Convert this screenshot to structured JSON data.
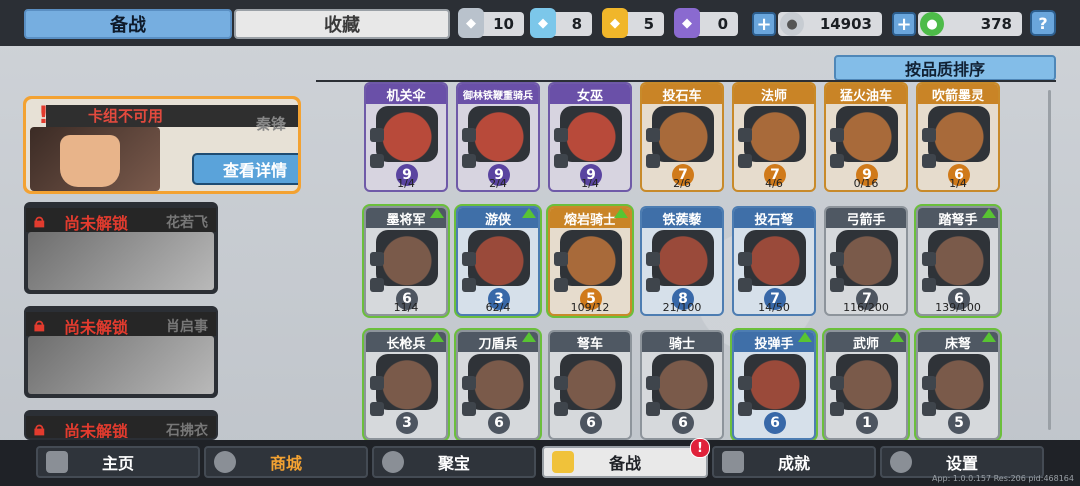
{
  "tabs": {
    "main": "备战",
    "collection": "收藏"
  },
  "resources": [
    {
      "name": "silver-shield",
      "value": "10",
      "color": "#b9c2cc"
    },
    {
      "name": "blue-shield",
      "value": "8",
      "color": "#7cc7ea"
    },
    {
      "name": "gold-shield",
      "value": "5",
      "color": "#f0b62a"
    },
    {
      "name": "purple-shield",
      "value": "0",
      "color": "#8a6ad0"
    }
  ],
  "currency": {
    "silver": "14903",
    "gem": "378"
  },
  "help": "?",
  "sort_button": "按品质排序",
  "commanders": {
    "active": {
      "status": "卡组不可用",
      "name": "秦锋",
      "detail_button": "查看详情"
    },
    "locked": [
      {
        "label": "尚未解锁",
        "name": "花若飞"
      },
      {
        "label": "尚未解锁",
        "name": "肖启事"
      },
      {
        "label": "尚未解锁",
        "name": "石拂衣"
      }
    ]
  },
  "units": [
    {
      "name": "机关伞",
      "level": "9",
      "count": "1/4",
      "rarity": "purple"
    },
    {
      "name": "御林铁鞭重骑兵",
      "level": "9",
      "count": "2/4",
      "rarity": "purple"
    },
    {
      "name": "女巫",
      "level": "9",
      "count": "1/4",
      "rarity": "purple"
    },
    {
      "name": "投石车",
      "level": "7",
      "count": "2/6",
      "rarity": "orange"
    },
    {
      "name": "法师",
      "level": "7",
      "count": "4/6",
      "rarity": "orange"
    },
    {
      "name": "猛火油车",
      "level": "9",
      "count": "0/16",
      "rarity": "orange"
    },
    {
      "name": "吹箭墨灵",
      "level": "6",
      "count": "1/4",
      "rarity": "orange"
    },
    {
      "name": "墨将军",
      "level": "6",
      "count": "11/4",
      "rarity": "gray",
      "upgrade": true
    },
    {
      "name": "游侠",
      "level": "3",
      "count": "62/4",
      "rarity": "blue",
      "upgrade": true
    },
    {
      "name": "熔岩骑士",
      "level": "5",
      "count": "109/12",
      "rarity": "orange",
      "upgrade": true
    },
    {
      "name": "铁蒺藜",
      "level": "8",
      "count": "21/100",
      "rarity": "blue"
    },
    {
      "name": "投石弩",
      "level": "7",
      "count": "14/50",
      "rarity": "blue"
    },
    {
      "name": "弓箭手",
      "level": "7",
      "count": "116/200",
      "rarity": "gray"
    },
    {
      "name": "踏弩手",
      "level": "6",
      "count": "139/100",
      "rarity": "gray",
      "upgrade": true
    },
    {
      "name": "长枪兵",
      "level": "3",
      "count": "",
      "rarity": "gray",
      "upgrade": true
    },
    {
      "name": "刀盾兵",
      "level": "6",
      "count": "",
      "rarity": "gray",
      "upgrade": true
    },
    {
      "name": "弩车",
      "level": "6",
      "count": "",
      "rarity": "gray"
    },
    {
      "name": "骑士",
      "level": "6",
      "count": "",
      "rarity": "gray"
    },
    {
      "name": "投弹手",
      "level": "6",
      "count": "",
      "rarity": "blue",
      "upgrade": true
    },
    {
      "name": "武师",
      "level": "1",
      "count": "",
      "rarity": "gray",
      "upgrade": true
    },
    {
      "name": "床弩",
      "level": "5",
      "count": "",
      "rarity": "gray",
      "upgrade": true
    }
  ],
  "nav": [
    {
      "label": "主页",
      "icon": "home-icon"
    },
    {
      "label": "商城",
      "icon": "coins-icon"
    },
    {
      "label": "聚宝",
      "icon": "treasure-icon"
    },
    {
      "label": "备战",
      "icon": "cards-icon"
    },
    {
      "label": "成就",
      "icon": "achievement-icon"
    },
    {
      "label": "设置",
      "icon": "gear-icon"
    }
  ],
  "nav_badge": "!",
  "version": "App: 1.0.0.157 Res:206 pid:468164"
}
